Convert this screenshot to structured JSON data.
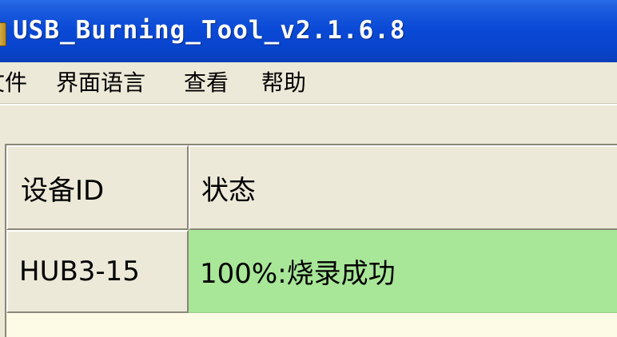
{
  "window": {
    "title": "USB_Burning_Tool_v2.1.6.8"
  },
  "menubar": {
    "items": [
      {
        "label": "文件"
      },
      {
        "label": "界面语言"
      },
      {
        "label": "查看"
      },
      {
        "label": "帮助"
      }
    ]
  },
  "table": {
    "columns": [
      "设备ID",
      "状态"
    ],
    "rows": [
      {
        "device_id": "HUB3-15",
        "status": "100%:烧录成功"
      }
    ]
  },
  "colors": {
    "titlebar": "#0a4ad6",
    "status_success": "#a8e698",
    "grid_background": "#fdfbe6",
    "chrome": "#ece9d8"
  }
}
